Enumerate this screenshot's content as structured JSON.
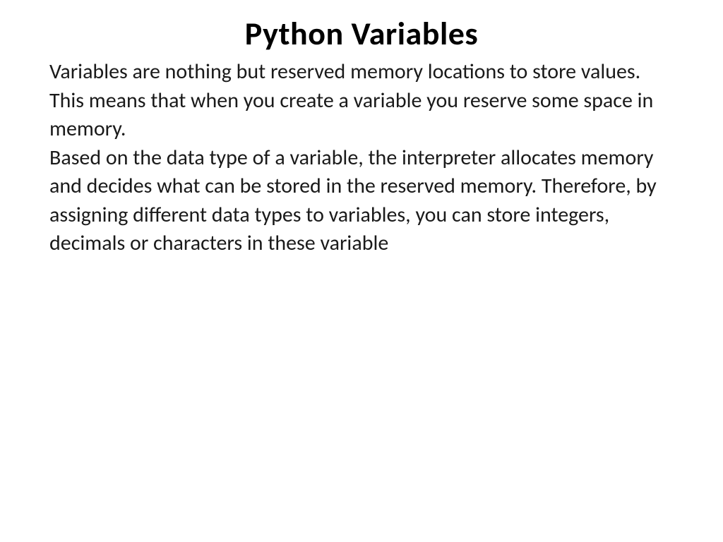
{
  "slide": {
    "title": "Python Variables",
    "paragraph1": "Variables are nothing but reserved memory locations to store values. This means that when you create a variable you reserve some space in memory.",
    "paragraph2": "Based on the data type of a variable, the interpreter allocates memory and decides what can be stored in the reserved memory. Therefore, by assigning different data types to variables, you can store integers, decimals or characters in these variable"
  }
}
